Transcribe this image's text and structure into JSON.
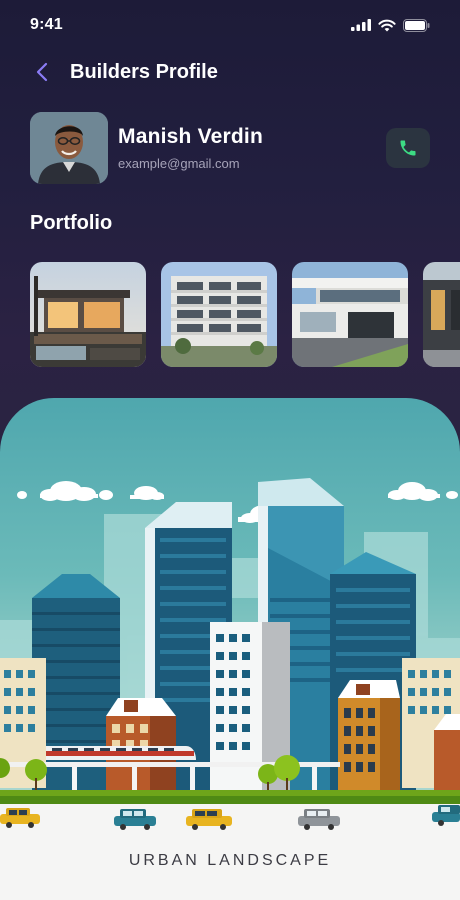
{
  "status_bar": {
    "time": "9:41"
  },
  "header": {
    "title": "Builders Profile"
  },
  "profile": {
    "name": "Manish Verdin",
    "email": "example@gmail.com"
  },
  "portfolio": {
    "title": "Portfolio",
    "items": [
      {
        "name": "modern-house"
      },
      {
        "name": "apartment-building"
      },
      {
        "name": "white-villa"
      },
      {
        "name": "dark-building"
      }
    ]
  },
  "hero": {
    "label": "URBAN  LANDSCAPE"
  },
  "colors": {
    "background": "#221f3f",
    "accent_call": "#3ddc84",
    "back_arrow": "#8b7cf6"
  }
}
